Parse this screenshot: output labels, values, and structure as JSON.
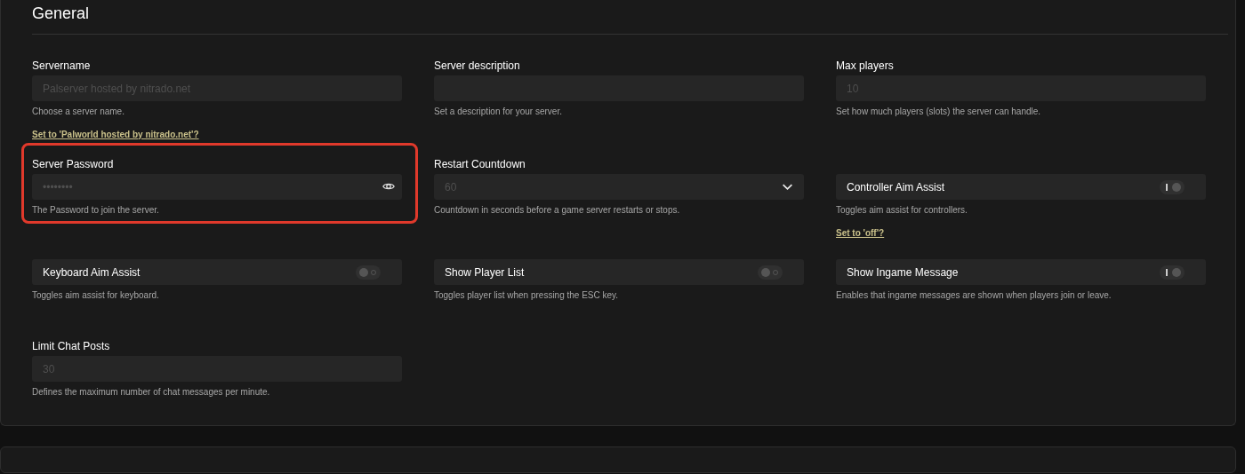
{
  "panel": {
    "title": "General"
  },
  "fields": [
    {
      "kind": "text",
      "label": "Servername",
      "placeholder": "Palserver hosted by nitrado.net",
      "help": "Choose a server name.",
      "suggestion": "Set to 'Palworld hosted by nitrado.net'?"
    },
    {
      "kind": "text",
      "label": "Server description",
      "help": "Set a description for your server."
    },
    {
      "kind": "text",
      "label": "Max players",
      "placeholder": "10",
      "help": "Set how much players (slots) the server can handle."
    },
    {
      "kind": "password",
      "label": "Server Password",
      "placeholder": "••••••••",
      "help": "The Password to join the server.",
      "highlighted": true
    },
    {
      "kind": "select",
      "label": "Restart Countdown",
      "placeholder": "60",
      "help": "Countdown in seconds before a game server restarts or stops."
    },
    {
      "kind": "toggle",
      "label": "Controller Aim Assist",
      "on": true,
      "help": "Toggles aim assist for controllers.",
      "suggestion": "Set to 'off'?"
    },
    {
      "kind": "toggle",
      "label": "Keyboard Aim Assist",
      "on": false,
      "help": "Toggles aim assist for keyboard."
    },
    {
      "kind": "toggle",
      "label": "Show Player List",
      "on": false,
      "help": "Toggles player list when pressing the ESC key."
    },
    {
      "kind": "toggle",
      "label": "Show Ingame Message",
      "on": true,
      "help": "Enables that ingame messages are shown when players join or leave."
    },
    {
      "kind": "text",
      "label": "Limit Chat Posts",
      "placeholder": "30",
      "help": "Defines the maximum number of chat messages per minute."
    }
  ]
}
